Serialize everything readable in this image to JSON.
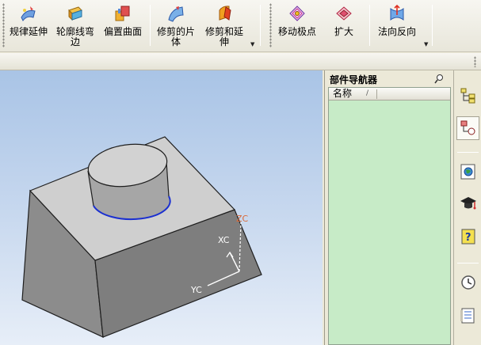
{
  "toolbar": {
    "buttons": [
      {
        "label": "规律延伸",
        "icon": "law-extension-icon"
      },
      {
        "label": "轮廓线弯边",
        "icon": "contour-flange-icon"
      },
      {
        "label": "偏置曲面",
        "icon": "offset-surface-icon"
      },
      {
        "label": "修剪的片体",
        "icon": "trimmed-sheet-icon"
      },
      {
        "label": "修剪和延伸",
        "icon": "trim-and-extend-icon"
      },
      {
        "label": "移动极点",
        "icon": "move-pole-icon"
      },
      {
        "label": "扩大",
        "icon": "enlarge-icon"
      },
      {
        "label": "法向反向",
        "icon": "reverse-normal-icon"
      }
    ],
    "overflow_glyph": "▼"
  },
  "viewport": {
    "axes": {
      "zc": "ZC",
      "xc": "XC",
      "yc": "YC"
    },
    "colors": {
      "background_top": "#a9c4e6",
      "zc_label": "#d86a3a",
      "axis": "#ffffff",
      "edge_highlight": "#1a2fd0"
    }
  },
  "navigator": {
    "title": "部件导航器",
    "column_name": "名称",
    "sort_glyph": "/",
    "list_background": "#c7ebc7"
  },
  "resource_bar": {
    "buttons": [
      {
        "icon": "assembly-navigator-icon",
        "active": false
      },
      {
        "icon": "part-navigator-icon",
        "active": true
      },
      {
        "icon": "web-browser-icon",
        "active": false
      },
      {
        "icon": "training-icon",
        "active": false
      },
      {
        "icon": "help-icon",
        "active": false
      },
      {
        "icon": "history-icon",
        "active": false
      },
      {
        "icon": "system-materials-icon",
        "active": false
      }
    ]
  }
}
